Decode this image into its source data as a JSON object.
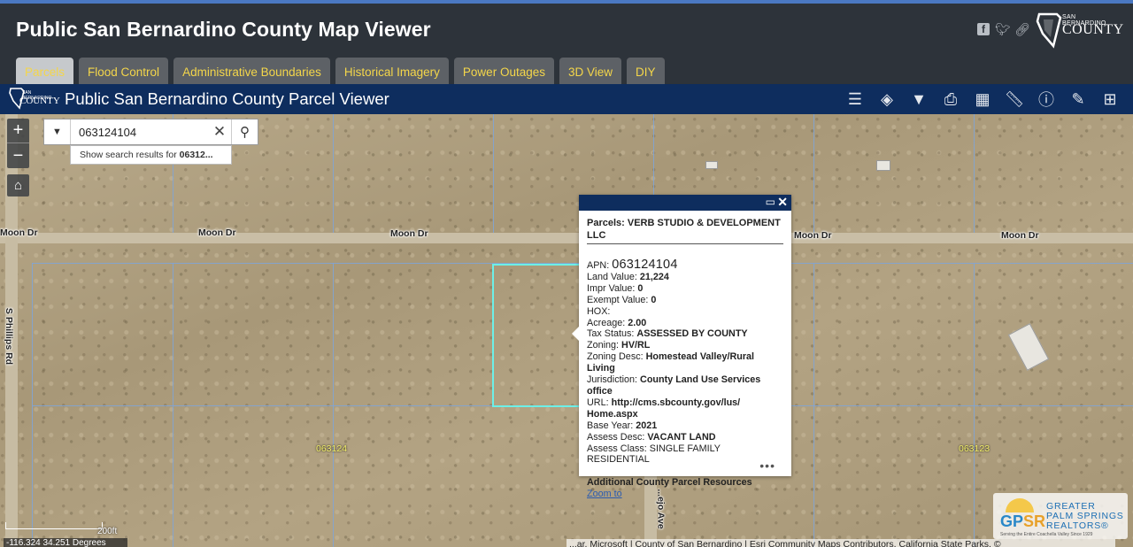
{
  "header": {
    "title": "Public San Bernardino County Map Viewer",
    "logo_small": "SAN BERNARDINO",
    "logo_big": "COUNTY",
    "social": [
      "facebook-icon",
      "twitter-icon",
      "link-icon"
    ]
  },
  "tabs": [
    {
      "label": "Parcels",
      "active": true
    },
    {
      "label": "Flood Control",
      "active": false
    },
    {
      "label": "Administrative Boundaries",
      "active": false
    },
    {
      "label": "Historical Imagery",
      "active": false
    },
    {
      "label": "Power Outages",
      "active": false
    },
    {
      "label": "3D View",
      "active": false
    },
    {
      "label": "DIY",
      "active": false
    }
  ],
  "toolbar": {
    "title": "Public San Bernardino County Parcel Viewer",
    "logo_small": "SAN BERNARDINO",
    "logo_big": "COUNTY",
    "tools": [
      "legend-icon",
      "layers-icon",
      "bookmark-icon",
      "print-icon",
      "basemap-gallery-icon",
      "measure-icon",
      "info-icon",
      "draw-icon",
      "add-data-icon"
    ]
  },
  "search": {
    "value": "063124104",
    "suggestion_prefix": "Show search results for ",
    "suggestion_bold": "06312..."
  },
  "map": {
    "roads": {
      "moon_dr": "Moon Dr",
      "phillips": "S Phillips Rd",
      "partial_ave": "...ejo Ave"
    },
    "parcel_labels": [
      "063124",
      "063123"
    ],
    "scale": "200ft",
    "coords": "-116.324 34.251 Degrees",
    "attribution": "...ar, Microsoft | County of San Bernardino | Esri Community Maps Contributors, California State Parks, ©"
  },
  "popup": {
    "title": "Parcels: VERB STUDIO & DEVELOPMENT LLC",
    "apn_label": "APN: ",
    "apn_value": "063124104",
    "rows": [
      {
        "label": "Land Value: ",
        "value": "21,224"
      },
      {
        "label": "Impr Value: ",
        "value": "0"
      },
      {
        "label": "Exempt Value: ",
        "value": "0"
      },
      {
        "label": "HOX:",
        "value": ""
      },
      {
        "label": "Acreage: ",
        "value": "2.00"
      },
      {
        "label": "Tax Status: ",
        "value": "ASSESSED BY COUNTY"
      },
      {
        "label": "Zoning: ",
        "value": "HV/RL"
      },
      {
        "label": "Zoning Desc: ",
        "value": "Homestead Valley/Rural Living"
      },
      {
        "label": "Jurisdiction: ",
        "value": "County Land Use Services office"
      },
      {
        "label": "URL: ",
        "value": "http://cms.sbcounty.gov/lus/ Home.aspx"
      },
      {
        "label": "Base Year: ",
        "value": "2021"
      },
      {
        "label": "Assess Desc: ",
        "value": "VACANT LAND"
      },
      {
        "label": "Assess Class: ",
        "value": "SINGLE FAMILY RESIDENTIAL"
      }
    ],
    "more_title": "Additional County Parcel Resources",
    "zoom_to": "Zoom to",
    "more": "•••"
  },
  "gpsr": {
    "letters_a": "GP",
    "letters_b": "SR",
    "name_line1": "GREATER",
    "name_line2": "PALM SPRINGS",
    "name_line3": "REALTORS®",
    "sub": "Serving the Entire Coachella Valley Since 1929"
  }
}
